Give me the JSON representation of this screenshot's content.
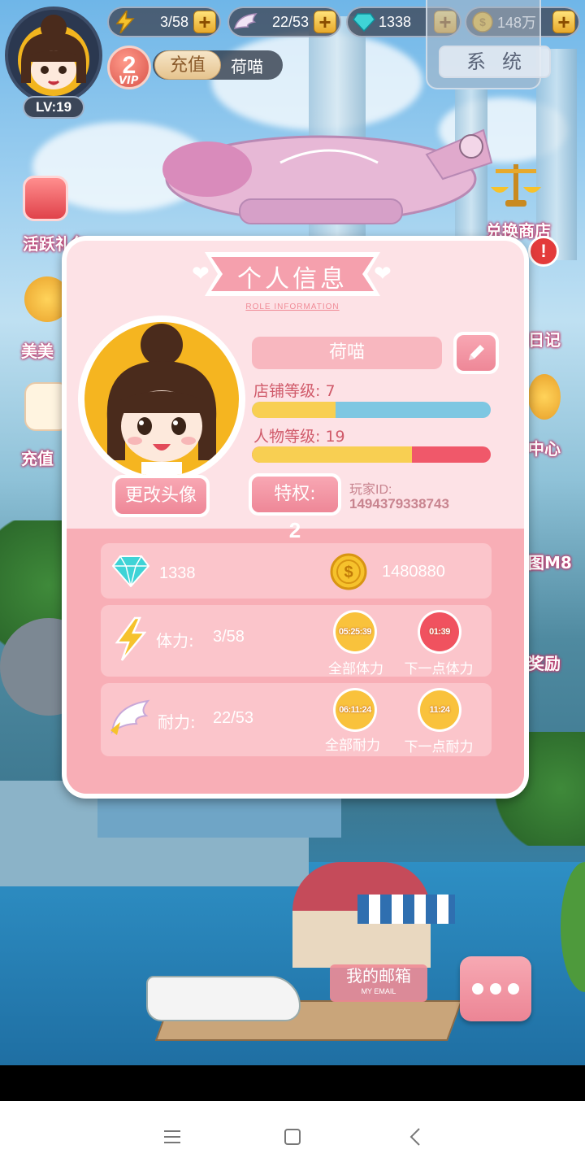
{
  "hud": {
    "level": "LV:19",
    "vip_level": "2",
    "vip_label": "VIP",
    "stamina": "3/58",
    "endurance": "22/53",
    "diamonds": "1338",
    "gold": "148万",
    "recharge_label": "充值",
    "player_name": "荷喵",
    "system_label": "系统"
  },
  "side_menu": {
    "activity_gift": "活跃礼包",
    "meimei": "美美",
    "recharge": "充值",
    "exchange_shop": "兑换商店",
    "diary": "日记",
    "center": "中心",
    "m8": "图M8",
    "reward": "奖励"
  },
  "modal": {
    "title": "个人信息",
    "subtitle": "ROLE INFORMATION",
    "player_name": "荷喵",
    "change_avatar": "更改头像",
    "shop_level_label": "店铺等级: 7",
    "shop_level_progress": 0.35,
    "char_level_label": "人物等级: 19",
    "char_level_progress": 0.67,
    "privilege_label": "特权:",
    "privilege_value": "2",
    "player_id_label": "玩家ID:",
    "player_id": "1494379338743",
    "diamonds": "1338",
    "gold": "1480880",
    "stamina_label": "体力:",
    "stamina_value": "3/58",
    "endurance_label": "耐力:",
    "endurance_value": "22/53",
    "clocks": [
      {
        "time": "05:25:39",
        "caption": "全部体力",
        "color": "#f9c23c"
      },
      {
        "time": "01:39",
        "caption": "下一点体力",
        "color": "#f0525f"
      },
      {
        "time": "06:11:24",
        "caption": "全部耐力",
        "color": "#f9c23c"
      },
      {
        "time": "11:24",
        "caption": "下一点耐力",
        "color": "#f9c23c"
      }
    ]
  },
  "bottom": {
    "mail_label": "我的邮箱",
    "mail_sub": "MY EMAIL"
  },
  "colors": {
    "modal_pink": "#fde2e6",
    "accent_pink": "#ee8797",
    "bar_blue": "#7ec7e2",
    "bar_red": "#f0586a",
    "bar_yellow": "#f8cf52"
  }
}
